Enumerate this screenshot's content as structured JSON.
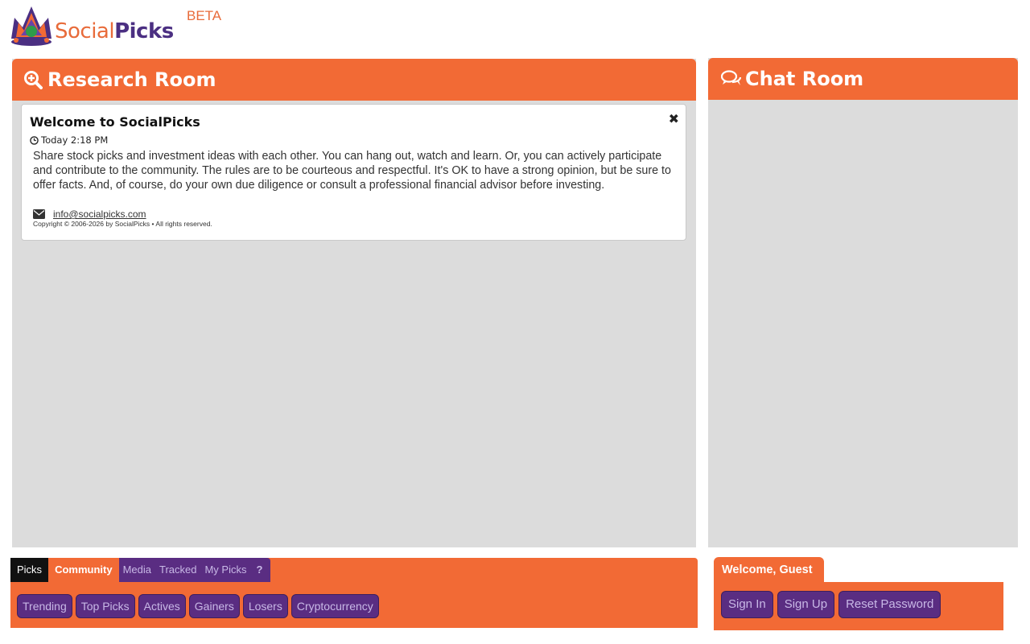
{
  "header": {
    "logo_social": "Social",
    "logo_picks": "Picks",
    "beta_label": "BETA",
    "logo_icon": "crown-icon"
  },
  "research_room": {
    "title": "Research Room",
    "icon": "search-plus-icon",
    "welcome_card": {
      "title": "Welcome to SocialPicks",
      "time": "Today 2:18 PM",
      "body": "Share stock picks and investment ideas with each other. You can hang out, watch and learn. Or, you can actively participate and contribute to the community. The rules are to be courteous and respectful. It's OK to have a strong opinion, but be sure to offer facts. And, of course, do your own due diligence or consult a professional financial advisor before investing.",
      "email": "info@socialpicks.com",
      "copyright": "Copyright © 2006-2026 by SocialPicks • All rights reserved.",
      "close_symbol": "✖"
    }
  },
  "chat_room": {
    "title": "Chat Room",
    "icon": "chat-bubbles-icon"
  },
  "nav": {
    "tabs": [
      "Picks",
      "Community",
      "Media",
      "Tracked",
      "My Picks",
      "?"
    ],
    "pills": [
      "Trending",
      "Top Picks",
      "Actives",
      "Gainers",
      "Losers",
      "Cryptocurrency"
    ]
  },
  "account": {
    "welcome": "Welcome, Guest",
    "buttons": [
      "Sign In",
      "Sign Up",
      "Reset Password"
    ]
  },
  "colors": {
    "accent_orange": "#f26a35",
    "accent_purple": "#5a2d82",
    "panel_gray": "#dcdcdc"
  }
}
